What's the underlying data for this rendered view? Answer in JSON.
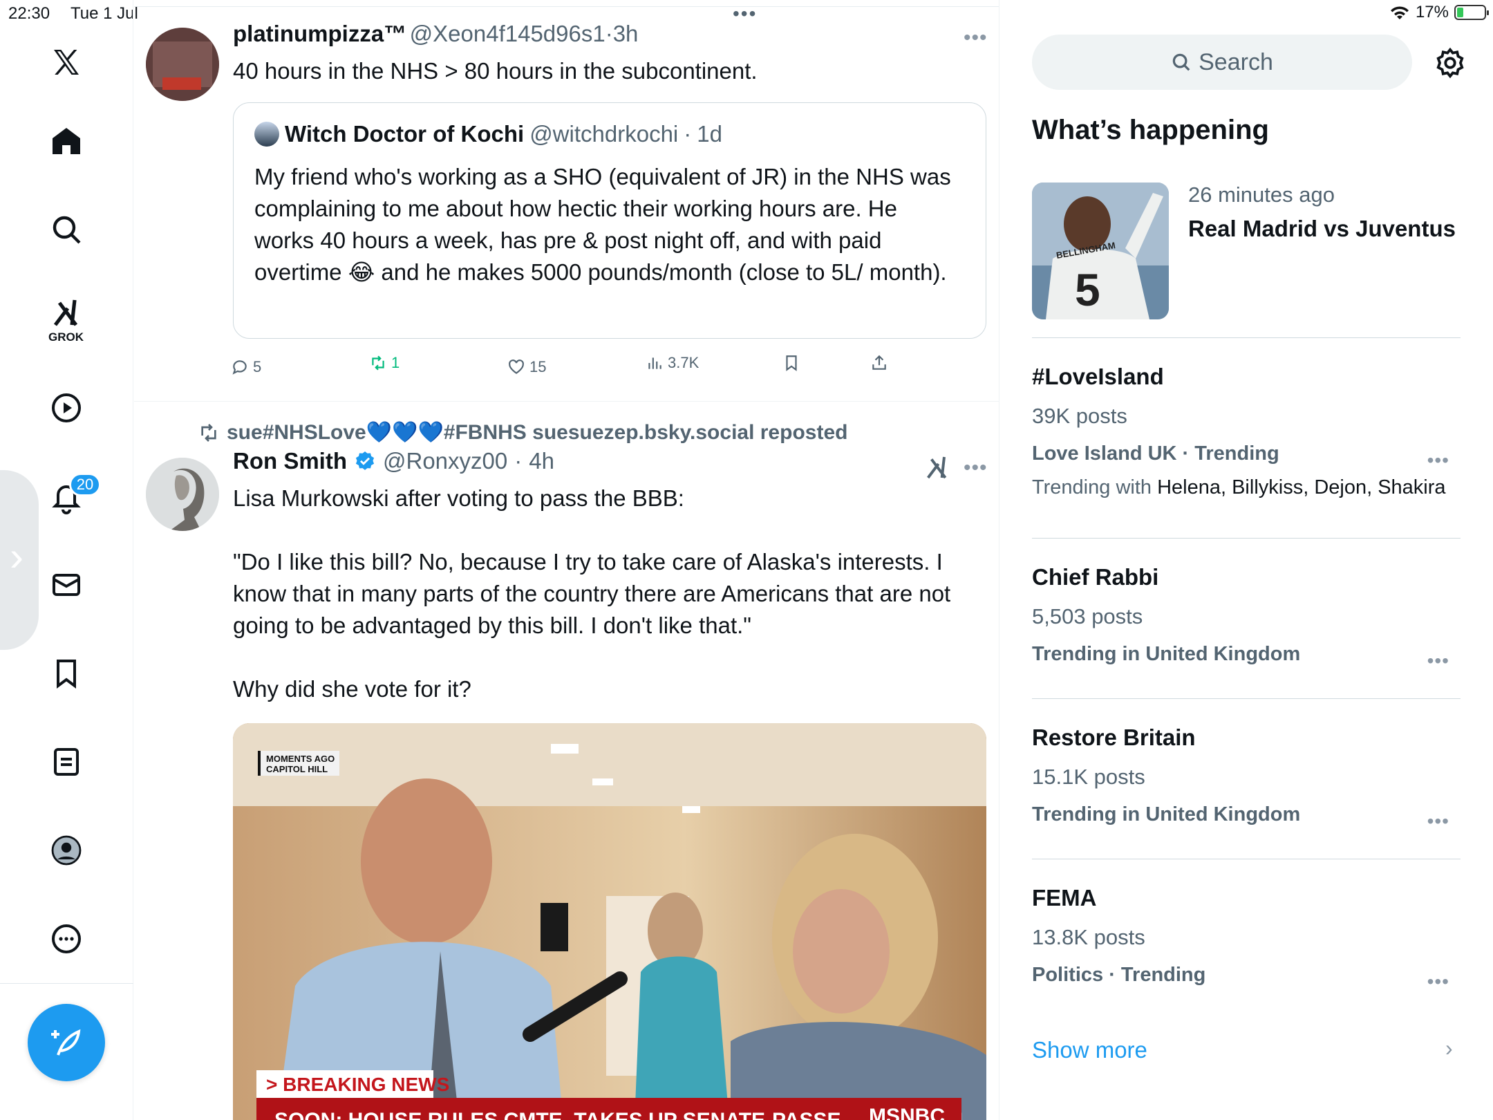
{
  "status_bar": {
    "time": "22:30",
    "date": "Tue 1 Jul",
    "battery": "17%"
  },
  "nav": {
    "grok_label": "GROK",
    "notifications_badge": "20",
    "items": [
      "home-icon",
      "search-icon",
      "grok-icon",
      "video-icon",
      "bell-icon",
      "mail-icon",
      "bookmark-icon",
      "list-icon",
      "profile-icon",
      "more-icon"
    ]
  },
  "tweets": [
    {
      "author_name": "platinumpizza™",
      "author_handle": "@Xeon4f145d96s1",
      "time": "3h",
      "text": "40 hours in the NHS > 80 hours in the subcontinent.",
      "avatar_label": "General Medical Council",
      "quote": {
        "author_name": "Witch Doctor of Kochi",
        "author_handle": "@witchdrkochi",
        "time": "1d",
        "text": "My friend who's working as a SHO (equivalent of JR) in the NHS was complaining to me about how hectic their working hours are. He works 40 hours a week, has pre & post night off, and with paid overtime 😂 and he makes 5000 pounds/month (close to 5L/ month)."
      },
      "actions": {
        "replies": "5",
        "reposts": "1",
        "likes": "15",
        "views": "3.7K"
      }
    },
    {
      "repost_label": "sue#NHSLove💙💙💙#FBNHS suesuezep.bsky.social reposted",
      "author_name": "Ron Smith",
      "author_handle": "@Ronxyz00",
      "time": "4h",
      "text_line1": "Lisa Murkowski after voting to pass the BBB:",
      "text_quote": "\"Do I like this bill? No, because I try to take care of Alaska's interests. I know that in many parts of the country there are Americans that are not going to be advantaged by this bill. I don't like that.\"",
      "text_line3": "Why did she vote for it?",
      "media": {
        "overlay_tag_line1": "MOMENTS AGO",
        "overlay_tag_line2": "CAPITOL HILL",
        "breaking": "> BREAKING NEWS",
        "ticker": "SOON: HOUSE RULES CMTE. TAKES UP SENATE-PASSED MEGABILL",
        "network": "MSNBC"
      }
    }
  ],
  "sidebar": {
    "search_placeholder": "Search",
    "section_title": "What’s happening",
    "featured": {
      "time": "26 minutes ago",
      "title": "Real Madrid vs Juventus",
      "jersey_name": "BELLINGHAM",
      "jersey_number": "5"
    },
    "trends": [
      {
        "title": "#LoveIsland",
        "posts": "39K posts",
        "context": "Love Island UK · Trending",
        "with_label": "Trending with",
        "with_names": "Helena, Billykiss, Dejon, Shakira"
      },
      {
        "title": "Chief Rabbi",
        "posts": "5,503 posts",
        "context": "Trending in United Kingdom"
      },
      {
        "title": "Restore Britain",
        "posts": "15.1K posts",
        "context": "Trending in United Kingdom"
      },
      {
        "title": "FEMA",
        "posts": "13.8K posts",
        "context": "Politics · Trending"
      }
    ],
    "show_more": "Show more"
  },
  "colors": {
    "accent": "#1d9bf0",
    "repost_green": "#00ba7c",
    "secondary_text": "#536471"
  }
}
